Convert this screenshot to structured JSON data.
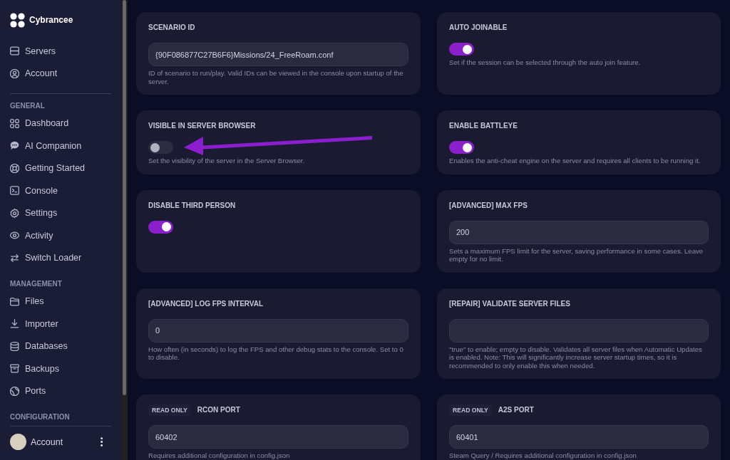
{
  "sidebar": {
    "brand": "Cybrancee",
    "sections": [
      {
        "items": [
          {
            "label": "Servers",
            "selected": false
          },
          {
            "label": "Account",
            "selected": false
          }
        ]
      },
      {
        "heading": "GENERAL",
        "items": [
          {
            "label": "Dashboard",
            "selected": false
          },
          {
            "label": "AI Companion",
            "selected": false
          },
          {
            "label": "Getting Started",
            "selected": false
          },
          {
            "label": "Console",
            "selected": false
          },
          {
            "label": "Settings",
            "selected": false
          },
          {
            "label": "Activity",
            "selected": false
          },
          {
            "label": "Switch Loader",
            "selected": false
          }
        ]
      },
      {
        "heading": "MANAGEMENT",
        "items": [
          {
            "label": "Files",
            "selected": false
          },
          {
            "label": "Importer",
            "selected": false
          },
          {
            "label": "Databases",
            "selected": false
          },
          {
            "label": "Backups",
            "selected": false
          },
          {
            "label": "Ports",
            "selected": false
          }
        ]
      },
      {
        "heading": "CONFIGURATION"
      }
    ],
    "user": {
      "name": "Account"
    }
  },
  "settings": [
    {
      "kind": "text",
      "title": "SCENARIO ID",
      "value": "{90F086877C27B6F6}Missions/24_FreeRoam.conf",
      "description": "ID of scenario to run/play. Valid IDs can be viewed in the console upon startup of the server."
    },
    {
      "kind": "toggle",
      "title": "AUTO JOINABLE",
      "on": true,
      "description": "Set if the session can be selected through the auto join feature."
    },
    {
      "kind": "toggle",
      "title": "VISIBLE IN SERVER BROWSER",
      "on": false,
      "description": "Set the visibility of the server in the Server Browser."
    },
    {
      "kind": "toggle",
      "title": "ENABLE BATTLEYE",
      "on": true,
      "description": "Enables the anti-cheat engine on the server and requires all clients to be running it."
    },
    {
      "kind": "toggle",
      "title": "DISABLE THIRD PERSON",
      "on": true
    },
    {
      "kind": "text",
      "title": "[ADVANCED] MAX FPS",
      "value": "200",
      "description": "Sets a maximum FPS limit for the server, saving performance in some cases. Leave empty for no limit."
    },
    {
      "kind": "text",
      "title": "[ADVANCED] LOG FPS INTERVAL",
      "value": "0",
      "description": "How often (in seconds) to log the FPS and other debug stats to the console. Set to 0 to disable."
    },
    {
      "kind": "text",
      "title": "[REPAIR] VALIDATE SERVER FILES",
      "description": "\"true\" to enable; empty to disable. Validates all server files when Automatic Updates is enabled. Note: This will significantly increase server startup times, so it is recommended to only enable this when needed."
    },
    {
      "kind": "text",
      "badge": "READ ONLY",
      "title": "RCON PORT",
      "value": "60402",
      "description": "Requires additional configuration in config.json"
    },
    {
      "kind": "text",
      "badge": "READ ONLY",
      "title": "A2S PORT",
      "value": "60401",
      "description": "Steam Query / Requires additional configuration in config.json"
    }
  ]
}
